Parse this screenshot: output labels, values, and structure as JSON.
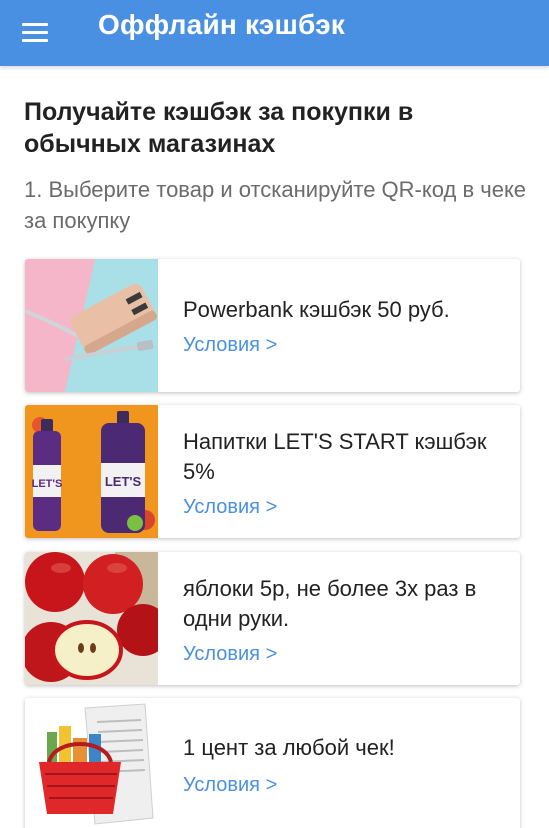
{
  "appbar": {
    "menu_icon": "hamburger-menu-icon",
    "title": "Оффлайн кэшбэк"
  },
  "intro": {
    "heading": "Получайте кэшбэк за покупки в обычных магазинах",
    "step": "1. Выберите товар и отсканируйте QR-код в чеке за покупку"
  },
  "offers": [
    {
      "text": "Powerbank  кэшбэк 50 руб.",
      "link": "Условия >",
      "image": "powerbank-image"
    },
    {
      "text": "Напитки LET'S START кэшбэк 5%",
      "link": "Условия >",
      "image": "drinks-image",
      "brand": "LET'S"
    },
    {
      "text": "яблоки 5р, не более 3х раз в одни руки.",
      "link": "Условия >",
      "image": "apples-image"
    },
    {
      "text": "1 цент за любой чек!",
      "link": "Условия >",
      "image": "receipt-basket-image"
    }
  ],
  "colors": {
    "appbar": "#4a90e2",
    "link": "#4a90e2",
    "step_text": "#6b6b6b"
  }
}
